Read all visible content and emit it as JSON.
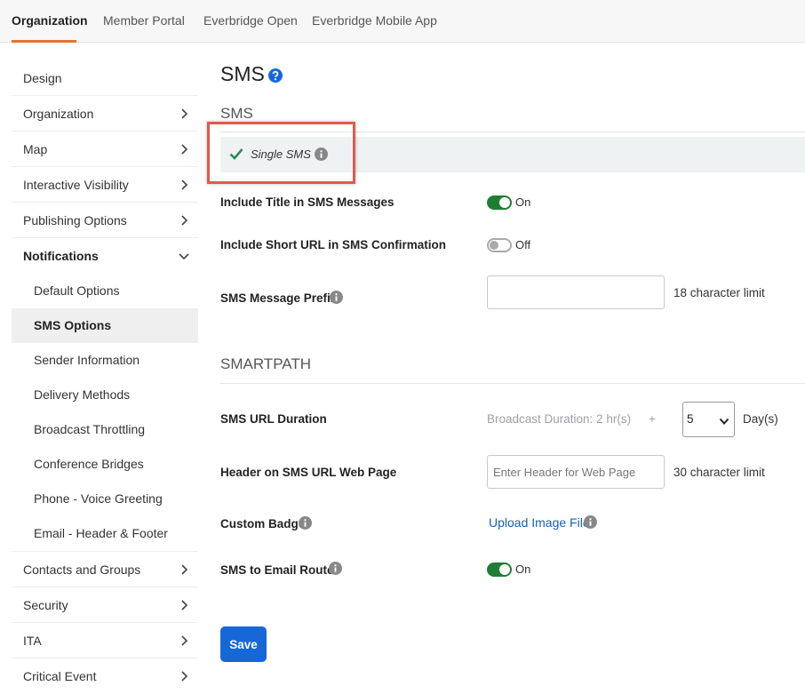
{
  "tabs": [
    {
      "label": "Organization"
    },
    {
      "label": "Member Portal"
    },
    {
      "label": "Everbridge Open"
    },
    {
      "label": "Everbridge Mobile App"
    }
  ],
  "sidebar": {
    "items": [
      {
        "label": "Design"
      },
      {
        "label": "Organization"
      },
      {
        "label": "Map"
      },
      {
        "label": "Interactive Visibility"
      },
      {
        "label": "Publishing Options"
      },
      {
        "label": "Notifications"
      },
      {
        "label": "Contacts and Groups"
      },
      {
        "label": "Security"
      },
      {
        "label": "ITA"
      },
      {
        "label": "Critical Event"
      }
    ],
    "subitems": [
      {
        "label": "Default Options"
      },
      {
        "label": "SMS Options"
      },
      {
        "label": "Sender Information"
      },
      {
        "label": "Delivery Methods"
      },
      {
        "label": "Broadcast Throttling"
      },
      {
        "label": "Conference Bridges"
      },
      {
        "label": "Phone - Voice Greeting"
      },
      {
        "label": "Email - Header & Footer"
      }
    ]
  },
  "main": {
    "title": "SMS",
    "sms_section": "SMS",
    "single_sms": "Single SMS",
    "include_title_label": "Include Title in SMS Messages",
    "include_title_state": "On",
    "include_url_label": "Include Short URL in SMS Confirmation",
    "include_url_state": "Off",
    "prefix_label": "SMS Message Prefix",
    "prefix_value": "",
    "prefix_hint": "18 character limit",
    "smartpath_section": "SMARTPATH",
    "url_duration_label": "SMS URL Duration",
    "broadcast_duration": "Broadcast Duration: 2 hr(s)",
    "plus": "+",
    "days_value": "5",
    "days_unit": "Day(s)",
    "header_label": "Header on SMS URL Web Page",
    "header_placeholder": "Enter Header for Web Page",
    "header_hint": "30 character limit",
    "badge_label": "Custom Badge",
    "upload_link": "Upload Image File",
    "router_label": "SMS to Email Router",
    "router_state": "On",
    "save_label": "Save"
  },
  "colors": {
    "accent_tab": "#e8712b",
    "toggle_on": "#1e7e34",
    "primary_button": "#1668d8",
    "link": "#1a5fb4",
    "highlight_box": "#e05a4e"
  }
}
